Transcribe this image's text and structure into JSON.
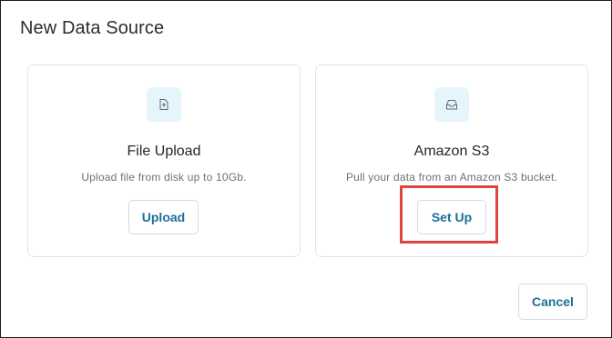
{
  "dialog": {
    "title": "New Data Source"
  },
  "cards": {
    "upload": {
      "icon": "file-upload-icon",
      "title": "File Upload",
      "description": "Upload file from disk up to 10Gb.",
      "button_label": "Upload"
    },
    "s3": {
      "icon": "inbox-tray-icon",
      "title": "Amazon S3",
      "description": "Pull your data from an Amazon S3 bucket.",
      "button_label": "Set Up"
    }
  },
  "footer": {
    "cancel_label": "Cancel"
  },
  "colors": {
    "accent_text": "#1a6f98",
    "icon_bg": "#e6f4fb",
    "highlight": "#e0443e"
  }
}
